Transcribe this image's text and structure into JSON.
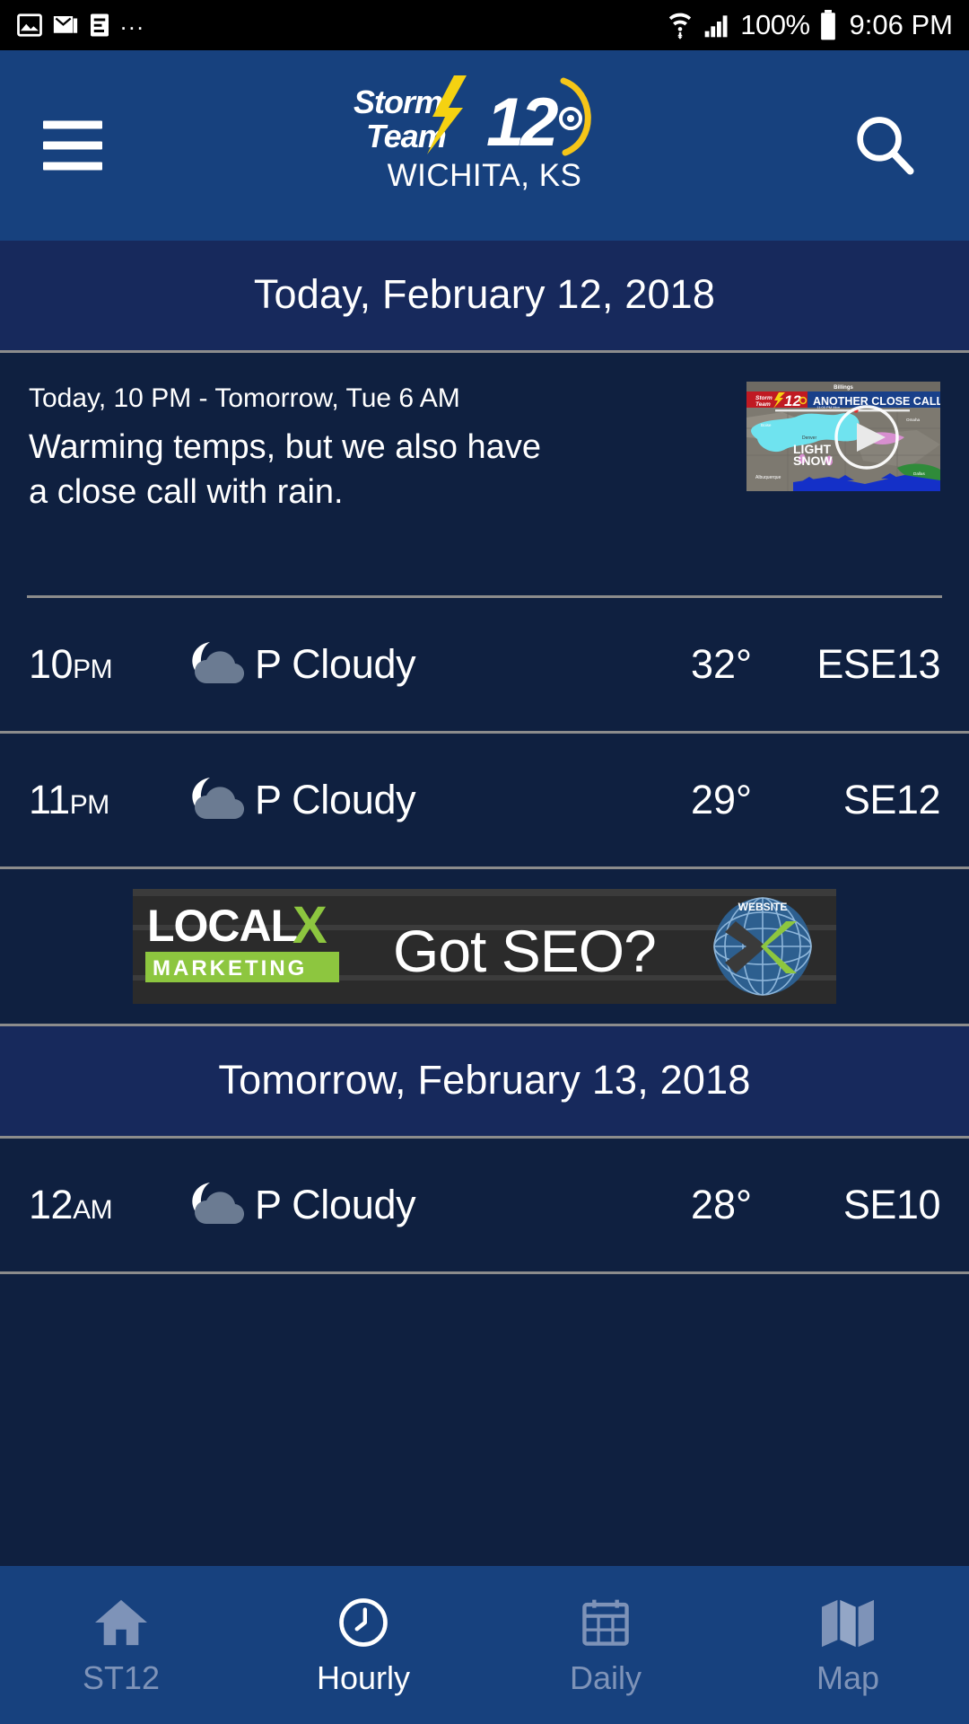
{
  "status_bar": {
    "icons": [
      "image-icon",
      "gmail-icon",
      "document-icon"
    ],
    "overflow": "...",
    "wifi": "wifi-icon",
    "signal": "cell-signal-icon",
    "battery_pct": "100%",
    "battery": "battery-icon",
    "time": "9:06 PM"
  },
  "header": {
    "menu": "hamburger-icon",
    "search": "search-icon",
    "logo": {
      "line1": "Storm",
      "line2": "Team",
      "number": "12",
      "bolt_color": "#f5d211",
      "arc_color": "#f5c518"
    },
    "city": "WICHITA, KS",
    "bg_color": "#17417e"
  },
  "sections": [
    {
      "date_label": "Today, February 12, 2018",
      "summary": {
        "range": "Today, 10 PM - Tomorrow, Tue 6 AM",
        "text": "Warming temps, but we also have a close call with rain.",
        "video": {
          "banner_title": "ANOTHER CLOSE CALL",
          "map_label": "LIGHT SNOW",
          "logo": "12",
          "play": "play-icon"
        }
      },
      "hours": [
        {
          "time": "10",
          "ampm": "PM",
          "icon": "moon-partly-cloudy-icon",
          "condition": "P Cloudy",
          "temp": "32°",
          "wind": "ESE13"
        },
        {
          "time": "11",
          "ampm": "PM",
          "icon": "moon-partly-cloudy-icon",
          "condition": "P Cloudy",
          "temp": "29°",
          "wind": "SE12"
        }
      ]
    },
    {
      "date_label": "Tomorrow, February 13, 2018",
      "hours": [
        {
          "time": "12",
          "ampm": "AM",
          "icon": "moon-partly-cloudy-icon",
          "condition": "P Cloudy",
          "temp": "28°",
          "wind": "SE10"
        }
      ]
    }
  ],
  "ad": {
    "brand_top": "LOCALX",
    "brand_x": "X",
    "brand_bottom": "MARKETING",
    "headline": "Got SEO?",
    "accent_color": "#8dc63f",
    "bg_color": "#2b2b2b"
  },
  "bottom_nav": {
    "items": [
      {
        "label": "ST12",
        "icon": "home-icon",
        "active": false
      },
      {
        "label": "Hourly",
        "icon": "clock-icon",
        "active": true
      },
      {
        "label": "Daily",
        "icon": "calendar-icon",
        "active": false
      },
      {
        "label": "Map",
        "icon": "map-icon",
        "active": false
      }
    ],
    "active_color": "#ffffff",
    "inactive_color": "#7e93b8"
  }
}
